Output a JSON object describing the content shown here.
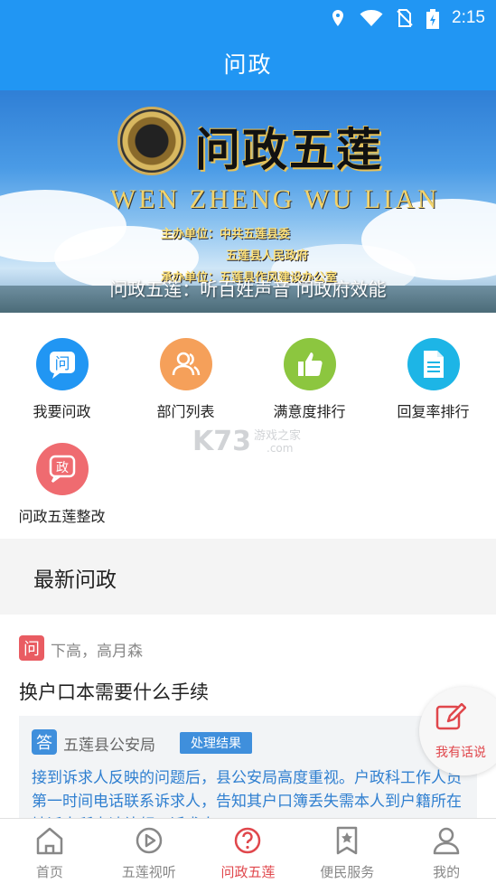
{
  "status_bar": {
    "time": "2:15",
    "icons": [
      "location-icon",
      "wifi-icon",
      "no-sim-icon",
      "battery-charging-icon"
    ]
  },
  "app_bar": {
    "title": "问政"
  },
  "banner": {
    "logo_text": "问政五莲",
    "pinyin": "WEN ZHENG WU LIAN",
    "host_label_1": "主办单位：中共五莲县委",
    "host_label_2": "五莲县人民政府",
    "host_label_3": "承办单位：五莲县作风建设办公室",
    "caption": "问政五莲：听百姓声音 问政府效能"
  },
  "actions": [
    {
      "label": "我要问政",
      "icon": "question-chat-icon",
      "color": "#2196f3"
    },
    {
      "label": "部门列表",
      "icon": "people-icon",
      "color": "#f5a05a"
    },
    {
      "label": "满意度排行",
      "icon": "thumbs-up-icon",
      "color": "#8cc63f"
    },
    {
      "label": "回复率排行",
      "icon": "document-icon",
      "color": "#1db5e6"
    },
    {
      "label": "问政五莲整改",
      "icon": "rectify-chat-icon",
      "color": "#ef6b70"
    }
  ],
  "watermark": {
    "brand": "K73",
    "sub": "游戏之家",
    "domain": ".com"
  },
  "section": {
    "title": "最新问政"
  },
  "card": {
    "tag": "问",
    "who": "下高，高月森",
    "question": "换户口本需要什么手续",
    "reply_tag": "答",
    "department": "五莲县公安局",
    "result_badge": "处理结果",
    "reply_body": "接到诉求人反映的问题后，县公安局高度重视。户政科工作人员第一时间电话联系诉求人，告知其户口簿丢失需本人到户籍所在地派出所申请补领，诉求人"
  },
  "fab": {
    "label": "我有话说",
    "icon": "edit-icon"
  },
  "bottom_nav": [
    {
      "label": "首页",
      "icon": "home-icon",
      "active": false
    },
    {
      "label": "五莲视听",
      "icon": "video-icon",
      "active": false
    },
    {
      "label": "问政五莲",
      "icon": "question-icon",
      "active": true
    },
    {
      "label": "便民服务",
      "icon": "star-bookmark-icon",
      "active": false
    },
    {
      "label": "我的",
      "icon": "user-icon",
      "active": false
    }
  ],
  "colors": {
    "primary": "#2196f3",
    "accent": "#e0474c",
    "reply_text": "#2f7fd0"
  }
}
